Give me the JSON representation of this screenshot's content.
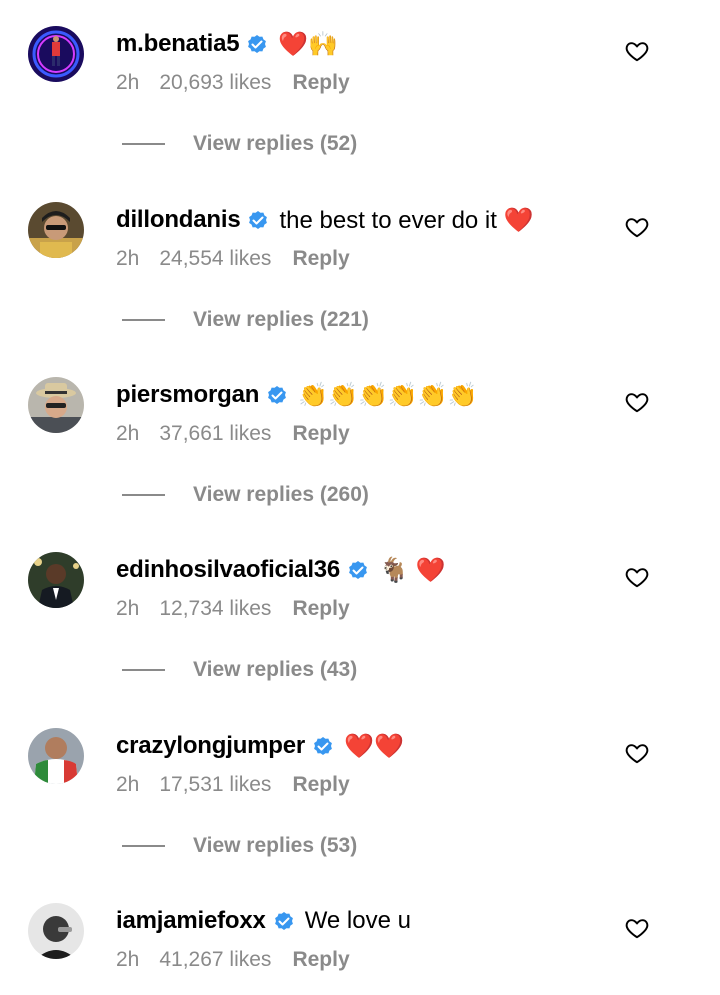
{
  "colors": {
    "secondary_text": "#8a8a8a",
    "verified_badge": "#3897f0",
    "primary_text": "#000000"
  },
  "comments": [
    {
      "username": "m.benatia5",
      "verified": true,
      "text": "❤️🙌",
      "time": "2h",
      "likes": "20,693 likes",
      "reply_label": "Reply",
      "view_replies": "View replies (52)",
      "avatar": "avatar-blue-neon"
    },
    {
      "username": "dillondanis",
      "verified": true,
      "text": "the best to ever do it ❤️",
      "time": "2h",
      "likes": "24,554 likes",
      "reply_label": "Reply",
      "view_replies": "View replies (221)",
      "avatar": "avatar-man-cap"
    },
    {
      "username": "piersmorgan",
      "verified": true,
      "text": "👏👏👏👏👏👏",
      "time": "2h",
      "likes": "37,661 likes",
      "reply_label": "Reply",
      "view_replies": "View replies (260)",
      "avatar": "avatar-man-hat"
    },
    {
      "username": "edinhosilvaoficial36",
      "verified": true,
      "text": "🐐 ❤️",
      "time": "2h",
      "likes": "12,734 likes",
      "reply_label": "Reply",
      "view_replies": "View replies (43)",
      "avatar": "avatar-man-suit"
    },
    {
      "username": "crazylongjumper",
      "verified": true,
      "text": "❤️❤️",
      "time": "2h",
      "likes": "17,531 likes",
      "reply_label": "Reply",
      "view_replies": "View replies (53)",
      "avatar": "avatar-man-flag"
    },
    {
      "username": "iamjamiefoxx",
      "verified": true,
      "text": "We love u",
      "time": "2h",
      "likes": "41,267 likes",
      "reply_label": "Reply",
      "view_replies": "",
      "avatar": "avatar-bw-portrait"
    }
  ]
}
